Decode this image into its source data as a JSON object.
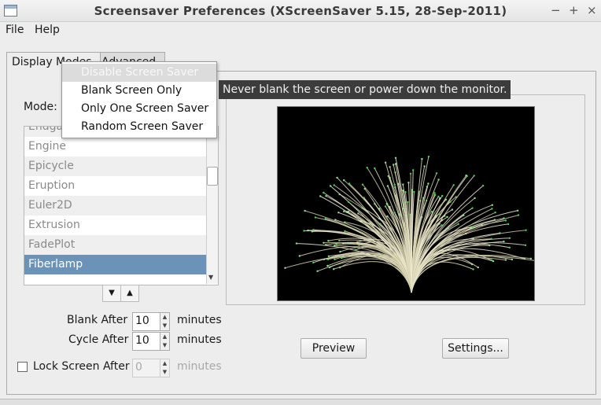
{
  "window": {
    "title": "Screensaver Preferences  (XScreenSaver 5.15, 28-Sep-2011)",
    "controls": [
      "−",
      "+",
      "×"
    ]
  },
  "menubar": {
    "items": [
      "File",
      "Help"
    ]
  },
  "tabs": [
    {
      "label": "Display Modes",
      "active": true
    },
    {
      "label": "Advanced",
      "active": false
    }
  ],
  "mode": {
    "label": "Mode:",
    "options": [
      "Disable Screen Saver",
      "Blank Screen Only",
      "Only One Screen Saver",
      "Random Screen Saver"
    ],
    "highlighted_index": 0
  },
  "tooltip": "Never blank the screen or power down the monitor.",
  "savers": {
    "items": [
      "Endgame",
      "Engine",
      "Epicycle",
      "Eruption",
      "Euler2D",
      "Extrusion",
      "FadePlot",
      "Fiberlamp"
    ],
    "selected": "Fiberlamp"
  },
  "settings": {
    "blank_after": {
      "label": "Blank After",
      "value": "10",
      "unit": "minutes"
    },
    "cycle_after": {
      "label": "Cycle After",
      "value": "10",
      "unit": "minutes"
    },
    "lock_screen": {
      "label": "Lock Screen After",
      "value": "0",
      "unit": "minutes",
      "checked": false
    }
  },
  "buttons": {
    "preview": "Preview",
    "settings": "Settings..."
  },
  "colors": {
    "selection": "#6b93b8",
    "tooltip_bg": "#3c3c3c",
    "preview_bg": "#000000"
  }
}
